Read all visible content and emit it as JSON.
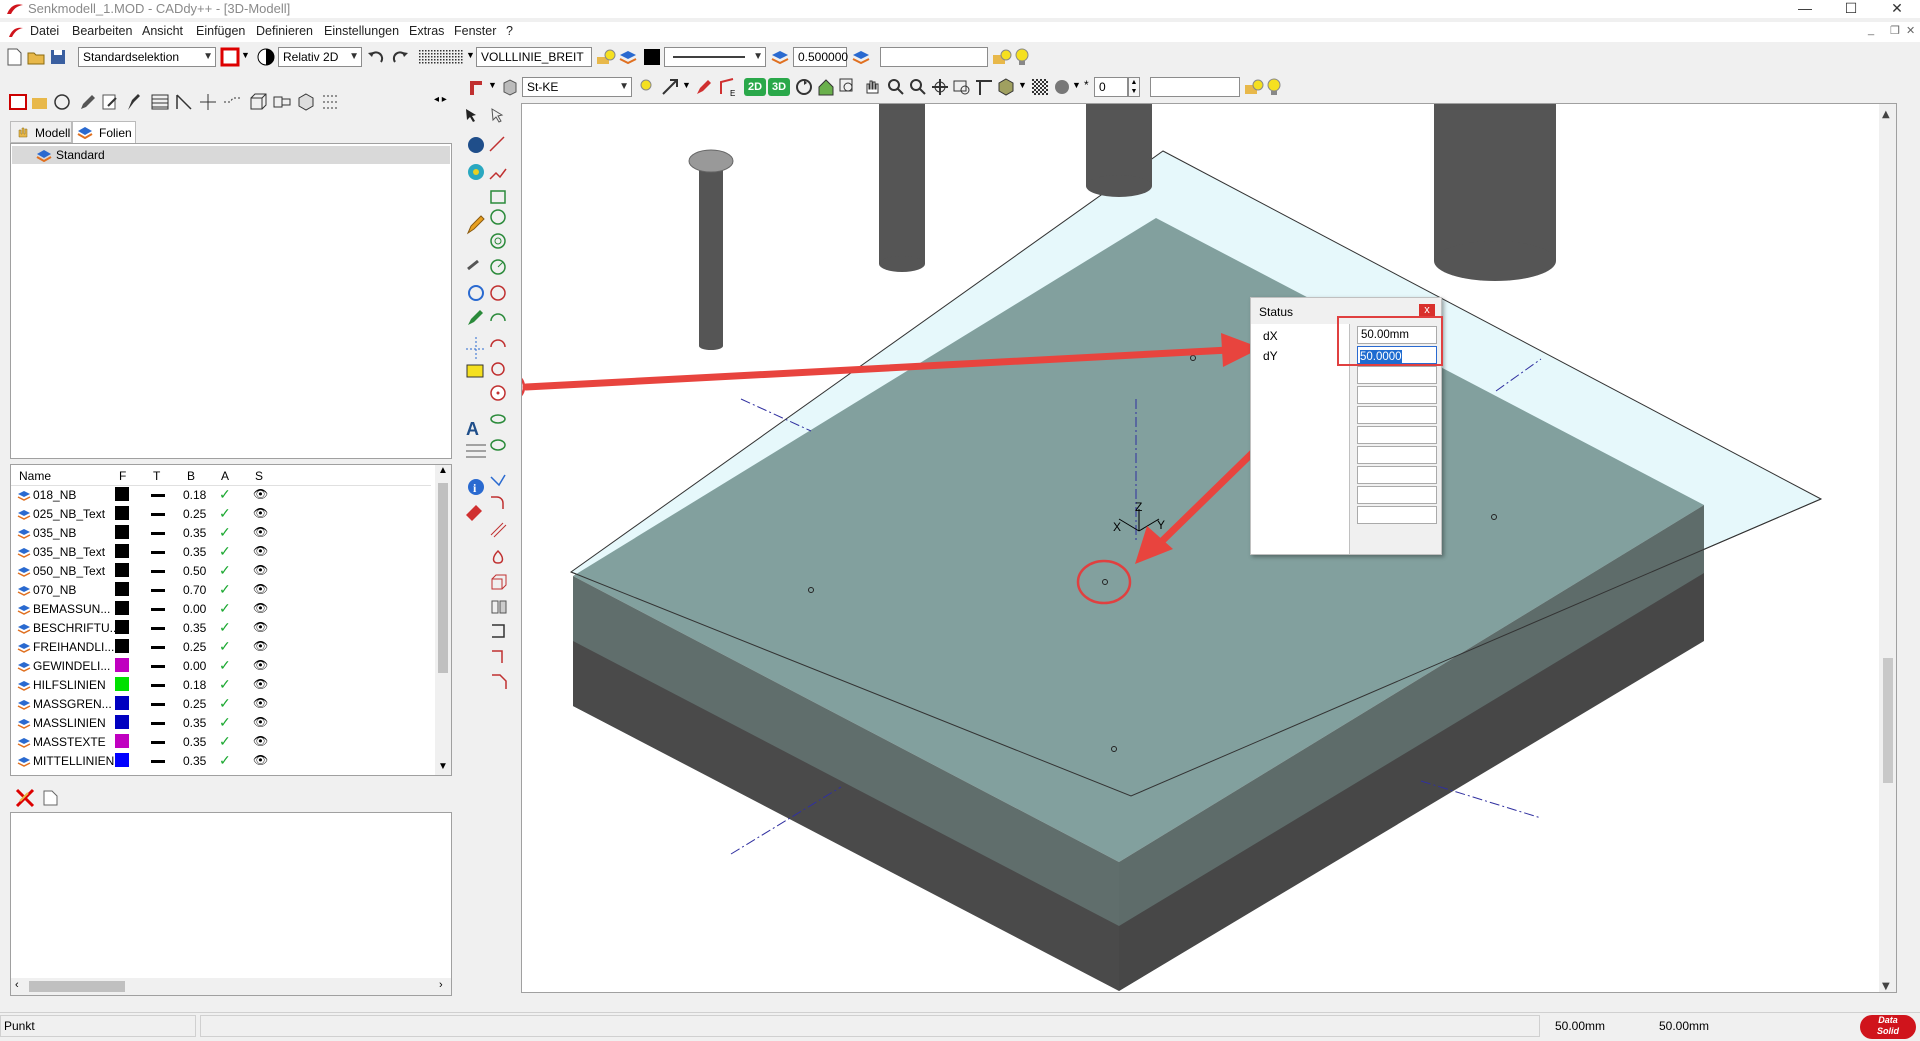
{
  "window": {
    "title": "Senkmodell_1.MOD  -  CADdy++ - [3D-Modell]",
    "minimize": "—",
    "maximize": "☐",
    "close": "✕"
  },
  "menu": [
    "Datei",
    "Bearbeiten",
    "Ansicht",
    "Einfügen",
    "Definieren",
    "Einstellungen",
    "Extras",
    "Fenster",
    "?"
  ],
  "toolbar1": {
    "selection_mode": "Standardselektion",
    "coord_mode": "Relativ 2D",
    "linetype": "VOLLLINIE_BREIT",
    "line_width": "0.500000",
    "extra_field": ""
  },
  "toolbar2": {
    "material": "St-KE",
    "btn_2d": "2D",
    "btn_3d": "3D",
    "spin_value": "0",
    "extra_field": ""
  },
  "left_tabs": {
    "modell": "Modell",
    "folien": "Folien"
  },
  "tree": {
    "root": "Standard"
  },
  "layers": {
    "columns": {
      "name": "Name",
      "f": "F",
      "t": "T",
      "b": "B",
      "a": "A",
      "s": "S"
    },
    "rows": [
      {
        "name": "018_NB",
        "color": "#000000",
        "width": "0.18"
      },
      {
        "name": "025_NB_Text",
        "color": "#000000",
        "width": "0.25"
      },
      {
        "name": "035_NB",
        "color": "#000000",
        "width": "0.35"
      },
      {
        "name": "035_NB_Text",
        "color": "#000000",
        "width": "0.35"
      },
      {
        "name": "050_NB_Text",
        "color": "#000000",
        "width": "0.50"
      },
      {
        "name": "070_NB",
        "color": "#000000",
        "width": "0.70"
      },
      {
        "name": "BEMASSUN...",
        "color": "#000000",
        "width": "0.00"
      },
      {
        "name": "BESCHRIFTU...",
        "color": "#000000",
        "width": "0.35"
      },
      {
        "name": "FREIHANDLI...",
        "color": "#000000",
        "width": "0.25"
      },
      {
        "name": "GEWINDELI...",
        "color": "#c000c0",
        "width": "0.00"
      },
      {
        "name": "HILFSLINIEN",
        "color": "#00e000",
        "width": "0.18"
      },
      {
        "name": "MASSGREN...",
        "color": "#0000c0",
        "width": "0.25"
      },
      {
        "name": "MASSLINIEN",
        "color": "#0000c0",
        "width": "0.35"
      },
      {
        "name": "MASSTEXTE",
        "color": "#c000c0",
        "width": "0.35"
      },
      {
        "name": "MITTELLINIEN",
        "color": "#0000ff",
        "width": "0.35"
      }
    ]
  },
  "status_dialog": {
    "title": "Status",
    "close": "x",
    "dx_label": "dX",
    "dx_value": "50.00mm",
    "dy_label": "dY",
    "dy_value": "50.0000"
  },
  "axes": {
    "x": "X",
    "y": "Y",
    "z": "Z"
  },
  "statusbar": {
    "prompt": "Punkt",
    "coord1": "50.00mm",
    "coord2": "50.00mm",
    "logo_line1": "Data",
    "logo_line2": "Solid"
  }
}
